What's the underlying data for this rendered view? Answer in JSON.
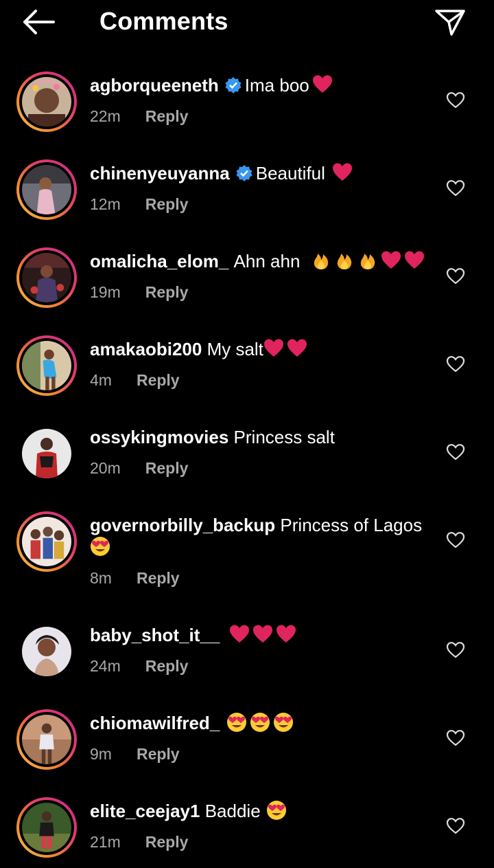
{
  "header": {
    "title": "Comments"
  },
  "comments": [
    {
      "username": "agborqueeneth",
      "text": "Ima boo",
      "emoji_tail": [
        "heart"
      ],
      "time": "22m",
      "reply": "Reply",
      "verified": true
    },
    {
      "username": "chinenyeuyanna",
      "text": "Beautiful",
      "emoji_tail": [
        "heart"
      ],
      "time": "12m",
      "reply": "Reply",
      "verified": true
    },
    {
      "username": "omalicha_elom_",
      "text": "Ahn ahn",
      "emoji_tail": [
        "fire",
        "fire",
        "fire",
        "heart",
        "heart"
      ],
      "time": "19m",
      "reply": "Reply",
      "verified": false
    },
    {
      "username": "amakaobi200",
      "text": "My salt",
      "emoji_tail": [
        "heart",
        "heart"
      ],
      "time": "4m",
      "reply": "Reply",
      "verified": false
    },
    {
      "username": "ossykingmovies",
      "text": "Princess salt",
      "emoji_tail": [],
      "time": "20m",
      "reply": "Reply",
      "verified": false
    },
    {
      "username": "governorbilly_backup",
      "text": "Princess of Lagos",
      "emoji_tail": [
        "heart-eyes"
      ],
      "time": "8m",
      "reply": "Reply",
      "verified": false
    },
    {
      "username": "baby_shot_it__",
      "text": "",
      "emoji_tail": [
        "heart",
        "heart",
        "heart"
      ],
      "time": "24m",
      "reply": "Reply",
      "verified": false
    },
    {
      "username": "chiomawilfred_",
      "text": "",
      "emoji_tail": [
        "heart-eyes",
        "heart-eyes",
        "heart-eyes"
      ],
      "time": "9m",
      "reply": "Reply",
      "verified": false
    },
    {
      "username": "elite_ceejay1",
      "text": "Baddie",
      "emoji_tail": [
        "heart-eyes"
      ],
      "time": "21m",
      "reply": "Reply",
      "verified": false
    }
  ],
  "icons": {
    "back": "arrow-left-icon",
    "share": "paper-plane-icon",
    "like": "heart-outline-icon",
    "verified": "verified-badge-icon"
  },
  "colors": {
    "background": "#000000",
    "text": "#ffffff",
    "meta": "#a8a8a8",
    "verified": "#3897f0",
    "heart": "#e0245e"
  }
}
